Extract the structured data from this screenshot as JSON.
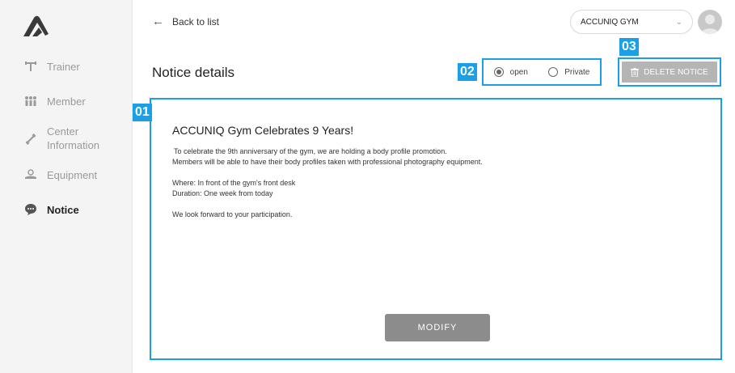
{
  "sidebar": {
    "logo_icon": "mountain-logo",
    "items": [
      {
        "label": "Trainer",
        "icon": "trainer-icon"
      },
      {
        "label": "Member",
        "icon": "member-icon"
      },
      {
        "label": "Center Information",
        "label_line1": "Center",
        "label_line2": "Information",
        "icon": "center-info-icon"
      },
      {
        "label": "Equipment",
        "icon": "equipment-icon"
      },
      {
        "label": "Notice",
        "icon": "notice-icon",
        "active": true
      }
    ]
  },
  "header": {
    "back_label": "Back to list",
    "gym_select_value": "ACCUNIQ GYM",
    "avatar_icon": "user-avatar"
  },
  "page": {
    "title": "Notice details"
  },
  "annotations": {
    "tag_01": "01",
    "tag_02": "02",
    "tag_03": "03"
  },
  "visibility": {
    "options": [
      {
        "label": "open",
        "selected": true
      },
      {
        "label": "Private",
        "selected": false
      }
    ]
  },
  "actions": {
    "delete_label": "DELETE NOTICE",
    "modify_label": "MODIFY"
  },
  "notice": {
    "title": "ACCUNIQ Gym Celebrates 9 Years!",
    "line1": "To celebrate the 9th anniversary of the gym, we are holding a body profile promotion.",
    "line2": "Members will be able to have their body profiles taken with professional photography equipment.",
    "line3": "Where: In front of the gym's front desk",
    "line4": "Duration: One week from today",
    "line5": "We look forward to your participation."
  },
  "colors": {
    "accent": "#1aa0e6",
    "sidebar_bg": "#f4f4f4",
    "button_gray": "#8c8c8c",
    "delete_gray": "#b5b5b5"
  }
}
